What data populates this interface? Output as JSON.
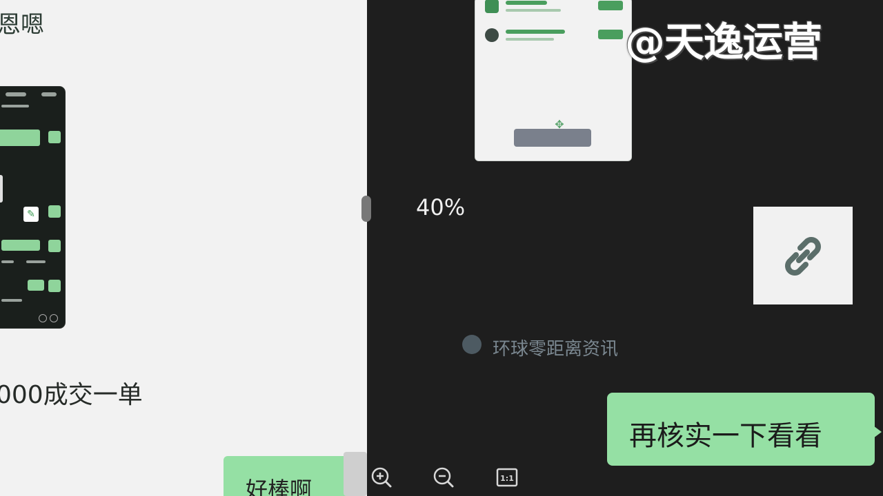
{
  "left_pane": {
    "top_text": "恩嗯",
    "bottom_text": "000成交一单",
    "bubble_text": "好棒啊"
  },
  "preview_card": {
    "rows": [
      {
        "icon": "app-icon"
      },
      {
        "icon": "app-icon"
      }
    ]
  },
  "watermark": "@天逸运营",
  "viewer": {
    "zoom_percent": "40%",
    "zoom_in_icon": "zoom-in-icon",
    "zoom_out_icon": "zoom-out-icon",
    "actual_size_label": "1:1"
  },
  "link_card": {
    "icon": "link-icon"
  },
  "source": {
    "name": "环球零距离资讯",
    "icon": "source-avatar-icon"
  },
  "chat": {
    "bubble_text": "再核实一下看看"
  },
  "colors": {
    "bubble_green": "#95e0a4",
    "dark_bg": "#1e1e1e",
    "light_bg": "#f2f2f2"
  }
}
